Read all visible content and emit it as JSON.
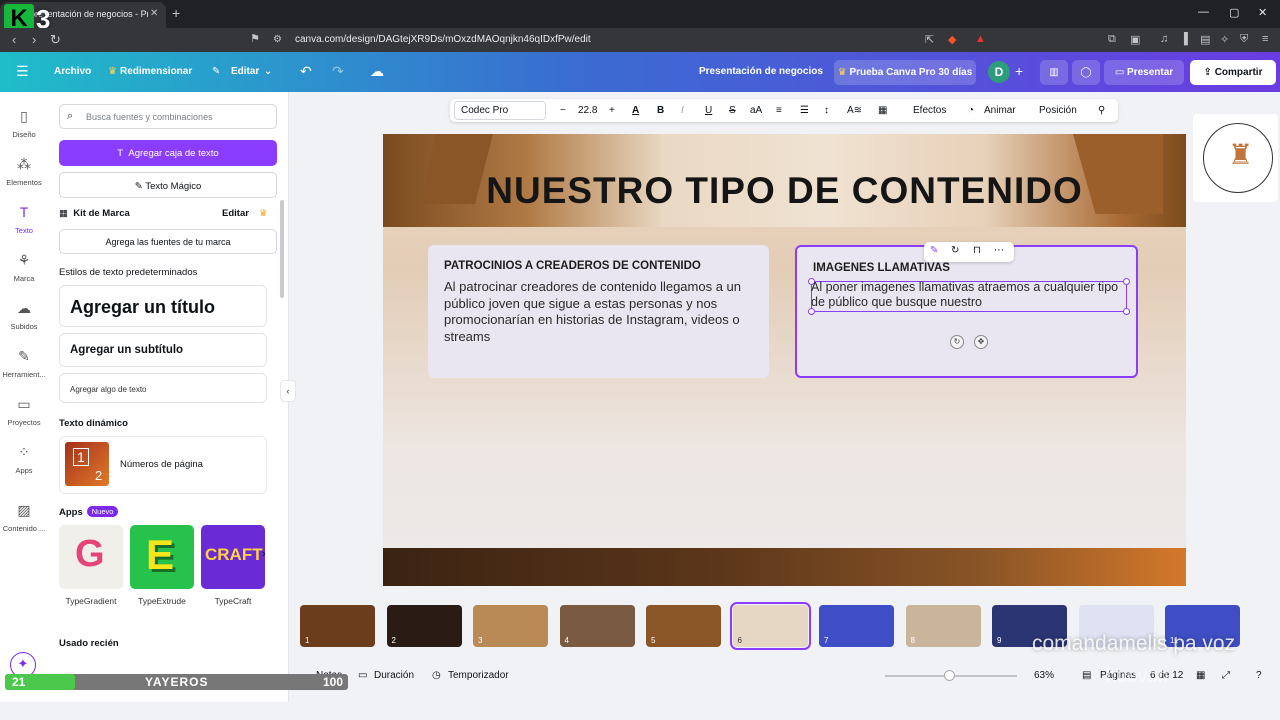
{
  "browser": {
    "tab_title": "presentación de negocios - Pres",
    "url": "canva.com/design/DAGtejXR9Ds/mOxzdMAOqnjkn46qIDxfPw/edit"
  },
  "topbar": {
    "archivo": "Archivo",
    "redimensionar": "Redimensionar",
    "editar": "Editar",
    "design_title": "Presentación de negocios",
    "trial": "Prueba Canva Pro 30 días",
    "avatar": "D",
    "presentar": "Presentar",
    "compartir": "Compartir"
  },
  "rail": [
    {
      "label": "Diseño",
      "icon": "design-icon"
    },
    {
      "label": "Elementos",
      "icon": "elements-icon"
    },
    {
      "label": "Texto",
      "icon": "text-icon"
    },
    {
      "label": "Marca",
      "icon": "brand-icon"
    },
    {
      "label": "Subidos",
      "icon": "uploads-icon"
    },
    {
      "label": "Herramient...",
      "icon": "tools-icon"
    },
    {
      "label": "Proyectos",
      "icon": "folder-icon"
    },
    {
      "label": "Apps",
      "icon": "apps-icon"
    },
    {
      "label": "Contenido ...",
      "icon": "content-icon"
    }
  ],
  "panel": {
    "search_placeholder": "Busca fuentes y combinaciones",
    "add_textbox": "Agregar caja de texto",
    "magic_text": "Texto Mágico",
    "brand_kit": "Kit de Marca",
    "brand_edit": "Editar",
    "brand_fonts": "Agrega las fuentes de tu marca",
    "default_styles": "Estilos de texto predeterminados",
    "add_title": "Agregar un título",
    "add_subtitle": "Agregar un subtítulo",
    "add_body": "Agregar algo de texto",
    "dynamic_text": "Texto dinámico",
    "page_numbers": "Números de página",
    "apps": "Apps",
    "new_badge": "Nuevo",
    "app_tiles": [
      "TypeGradient",
      "TypeExtrude",
      "TypeCraft"
    ],
    "recent": "Usado recién"
  },
  "text_toolbar": {
    "font": "Codec Pro",
    "size": "22.8",
    "effects": "Efectos",
    "animate": "Animar",
    "position": "Posición"
  },
  "slide": {
    "title": "NUESTRO TIPO DE CONTENIDO",
    "card1_heading": "PATROCINIOS A CREADEROS DE CONTENIDO",
    "card1_body": "Al patrocinar creadores de contenido llegamos a un público joven que sigue a estas personas y nos promocionarían en historias de Instagram, videos o streams",
    "card2_heading": "IMAGENES LLAMATIVAS",
    "card2_body": "Al poner imagenes llamativas atraemos a cualquier tipo de público que busque nuestro"
  },
  "filmstrip": [
    {
      "num": "1",
      "bg": "#6b3d1c"
    },
    {
      "num": "2",
      "bg": "#2a1c14"
    },
    {
      "num": "3",
      "bg": "#b98a55"
    },
    {
      "num": "4",
      "bg": "#7a5a40"
    },
    {
      "num": "5",
      "bg": "#8a5527"
    },
    {
      "num": "6",
      "bg": "#e6d6c4"
    },
    {
      "num": "7",
      "bg": "#3f4ec4"
    },
    {
      "num": "8",
      "bg": "#c9b49c"
    },
    {
      "num": "9",
      "bg": "#2b3574"
    },
    {
      "num": "10",
      "bg": "#dfe2f3"
    },
    {
      "num": "11",
      "bg": "#3f4ec4"
    }
  ],
  "bottombar": {
    "notes": "Notas",
    "duration": "Duración",
    "timer": "Temporizador",
    "zoom": "63%",
    "pages": "Páginas",
    "page_of": "6 de 12"
  },
  "overlay": {
    "level": "21",
    "player": "YAYEROS",
    "count": "100",
    "caption": "comandamelis pa voz",
    "caption2": "huevón"
  },
  "colors": {
    "accent": "#8b3dff",
    "topbar_start": "#1fbdc9",
    "topbar_end": "#6a3be2"
  }
}
